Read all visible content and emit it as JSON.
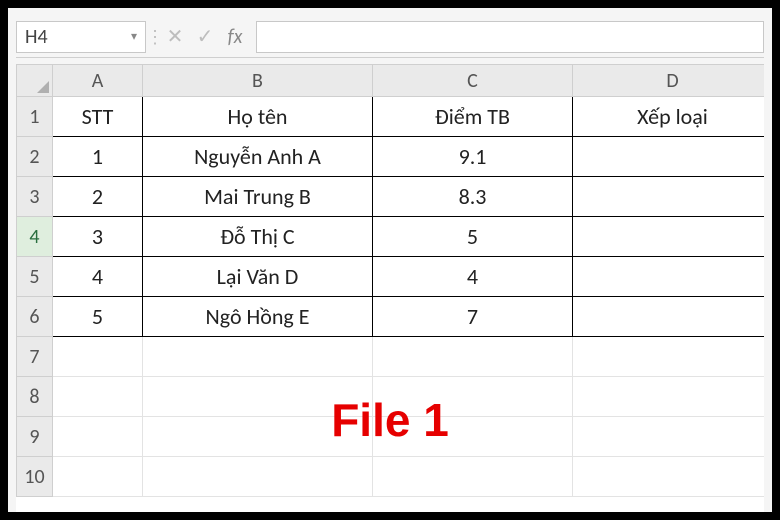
{
  "nameBox": {
    "value": "H4"
  },
  "formulaBar": {
    "value": ""
  },
  "columns": [
    "A",
    "B",
    "C",
    "D"
  ],
  "rowNumbers": [
    1,
    2,
    3,
    4,
    5,
    6,
    7,
    8,
    9,
    10
  ],
  "activeRow": 4,
  "headerRow": {
    "A": "STT",
    "B": "Họ tên",
    "C": "Điểm TB",
    "D": "Xếp loại"
  },
  "dataRows": [
    {
      "A": "1",
      "B": "Nguyễn Anh A",
      "C": "9.1",
      "D": ""
    },
    {
      "A": "2",
      "B": "Mai Trung B",
      "C": "8.3",
      "D": ""
    },
    {
      "A": "3",
      "B": "Đỗ Thị C",
      "C": "5",
      "D": ""
    },
    {
      "A": "4",
      "B": "Lại Văn D",
      "C": "4",
      "D": ""
    },
    {
      "A": "5",
      "B": "Ngô Hồng E",
      "C": "7",
      "D": ""
    }
  ],
  "overlay": {
    "label": "File 1"
  },
  "icons": {
    "dropdown": "▾",
    "separator": "⋮",
    "cancel": "✕",
    "confirm": "✓",
    "fx": "fx"
  }
}
